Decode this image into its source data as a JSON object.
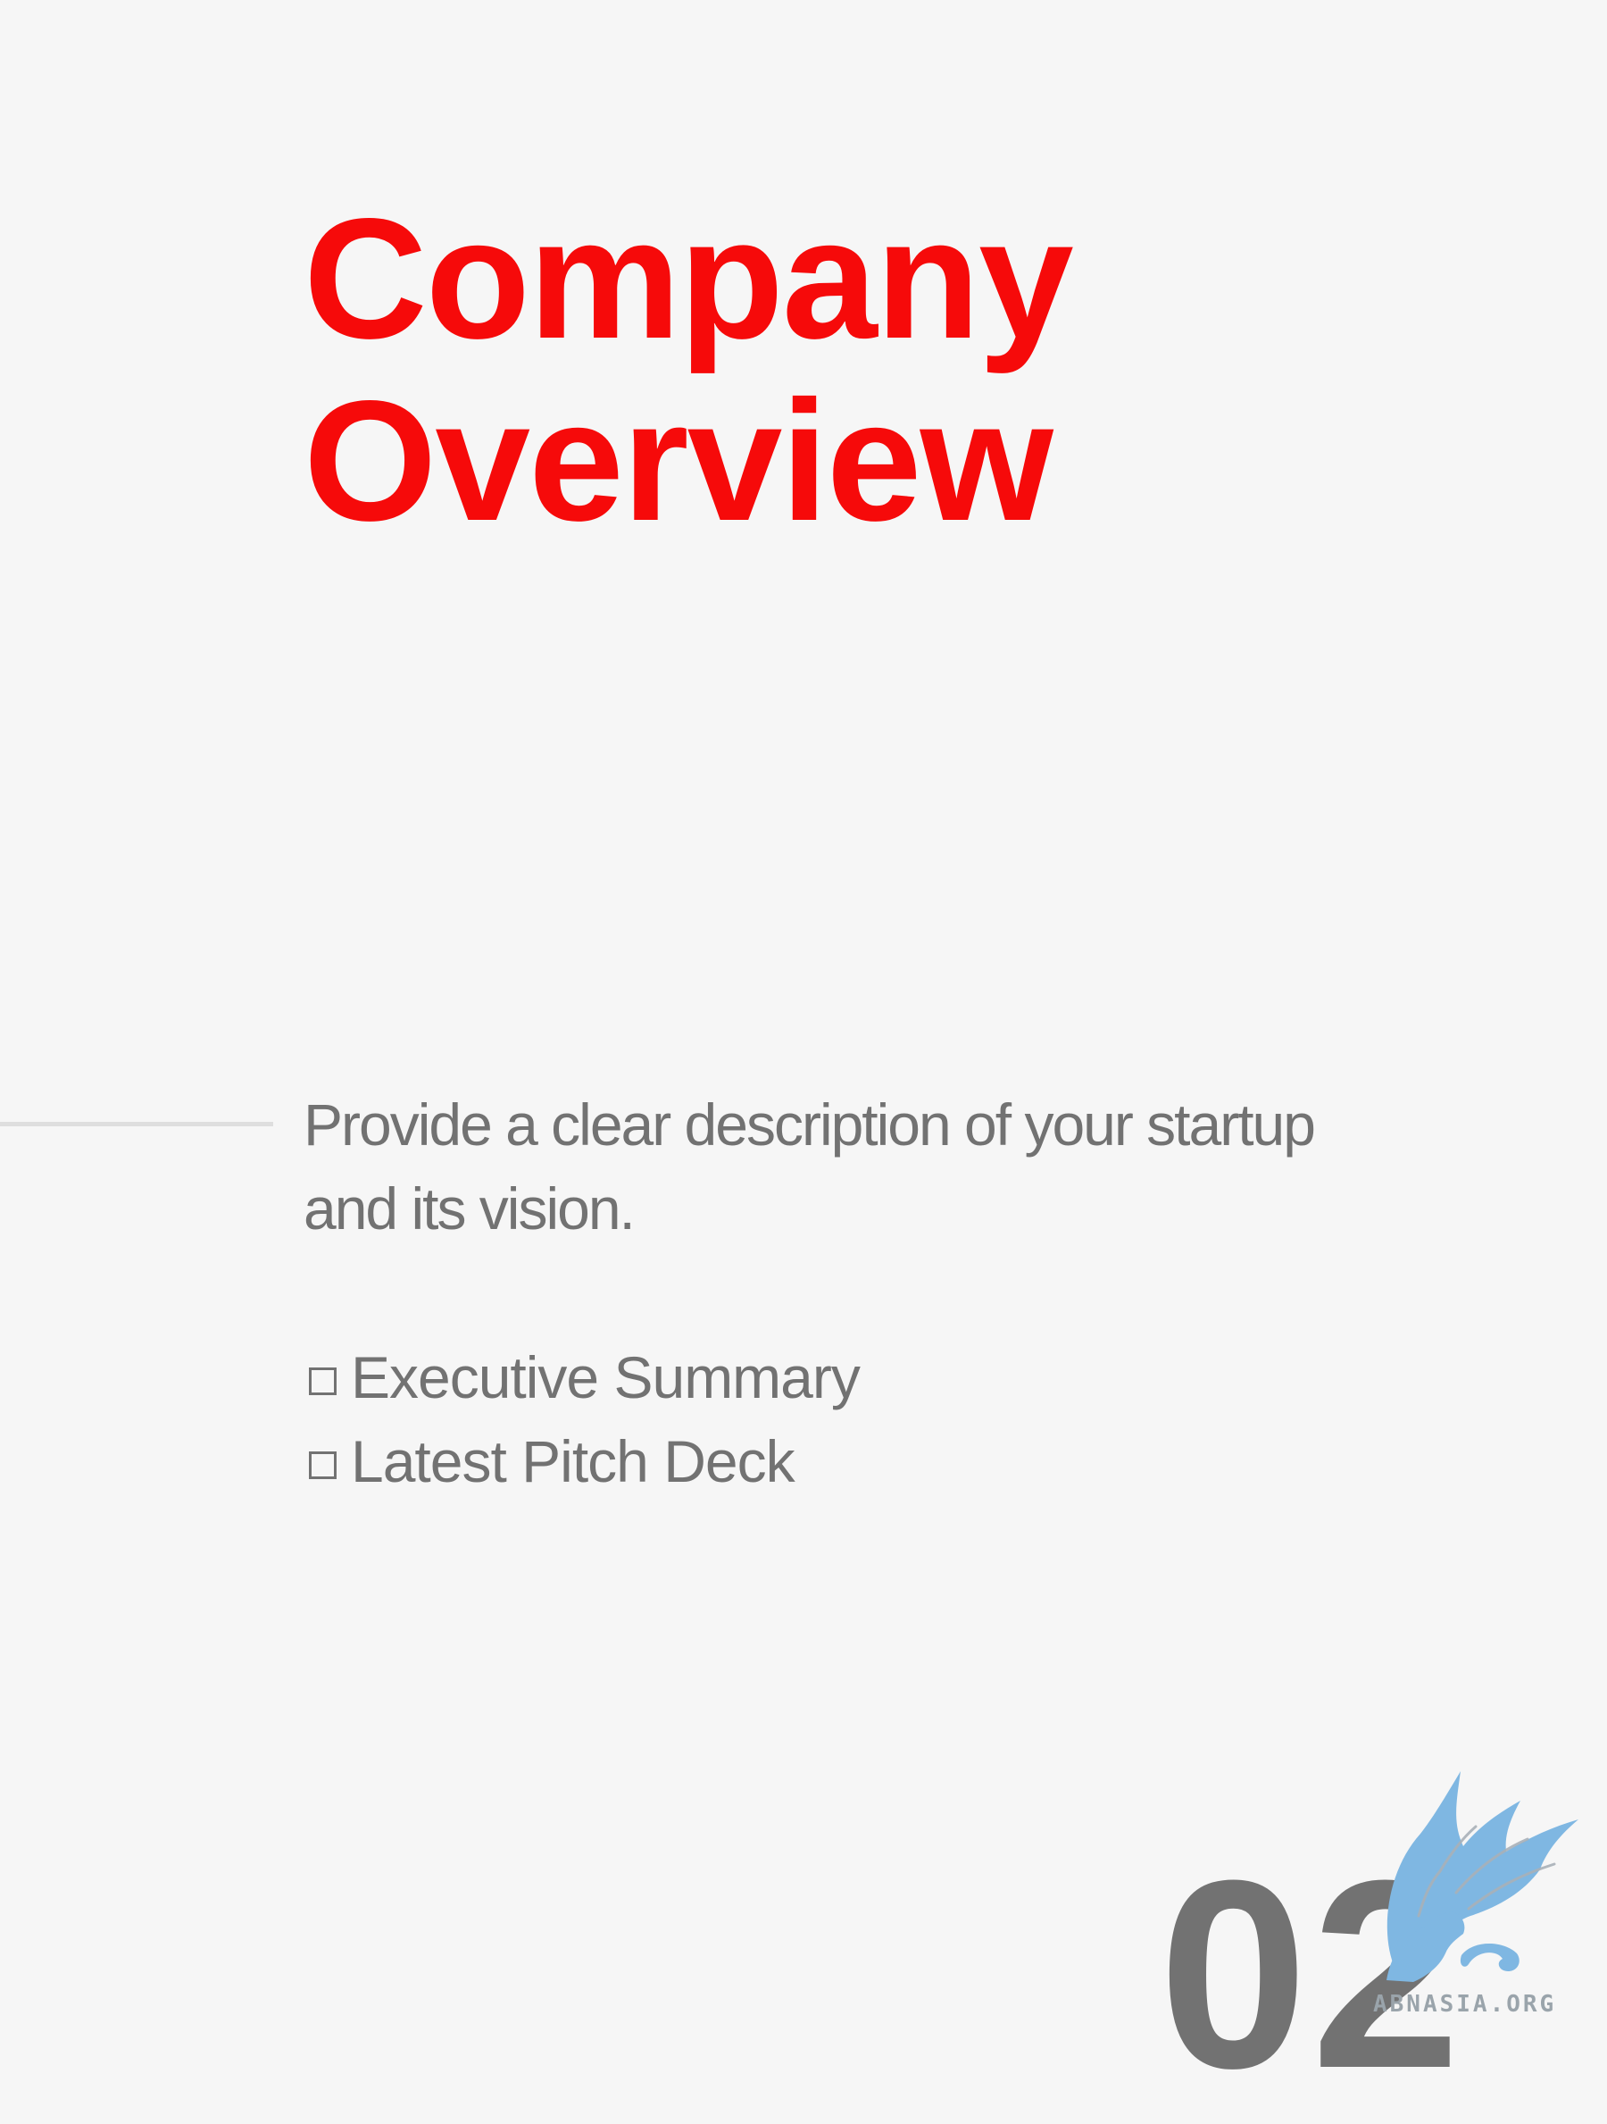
{
  "slide": {
    "title_lines": [
      "Company",
      "Overview"
    ],
    "description": "Provide a clear description of your startup and its vision.",
    "checklist": [
      {
        "label": "Executive Summary",
        "checked": false
      },
      {
        "label": "Latest Pitch Deck",
        "checked": false
      }
    ],
    "page_number": "02"
  },
  "watermark": {
    "text": "ABNASIA.ORG",
    "icon": "griffin-logo-icon"
  },
  "colors": {
    "background": "#f6f6f6",
    "title": "#f60a0a",
    "body_text": "#727272",
    "rule": "#dedede",
    "logo": "#7fb7e2"
  }
}
